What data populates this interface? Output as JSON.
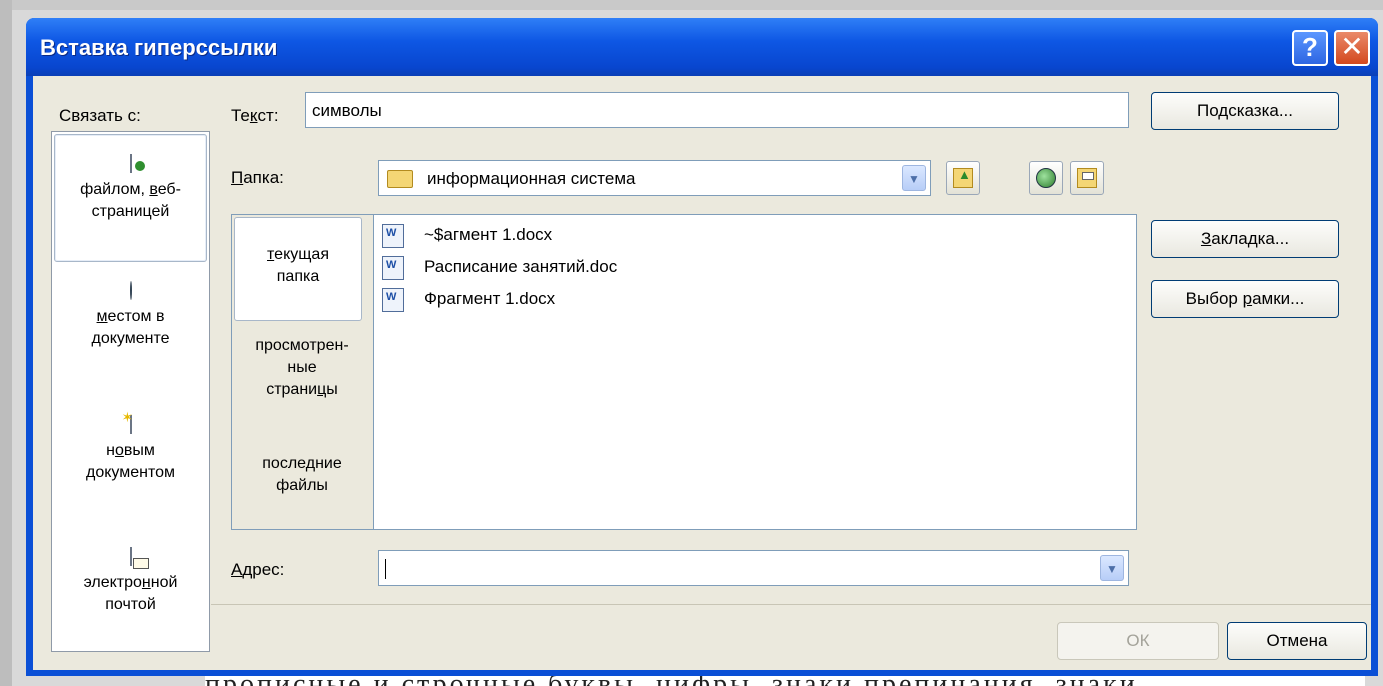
{
  "backdrop": {
    "partial_text": "прописные и строчные буквы, цифры, знаки препинания, знаки"
  },
  "dialog": {
    "title": "Вставка гиперссылки",
    "help_glyph": "?",
    "close_glyph": "✕"
  },
  "link_with": {
    "label": "Связать с:",
    "items": [
      {
        "line1": "файлом, ",
        "line1_u": "в",
        "line1_rest": "еб-",
        "line2": "страницей",
        "icon": "web-page-file-icon",
        "active": true
      },
      {
        "line1_u": "м",
        "line1_rest": "естом в",
        "line2": "документе",
        "icon": "place-in-document-icon",
        "active": false
      },
      {
        "line1": "н",
        "line1_u": "о",
        "line1_rest": "вым",
        "line2": "документом",
        "icon": "new-document-icon",
        "active": false
      },
      {
        "line1": "электро",
        "line1_u": "н",
        "line1_rest": "ной",
        "line2": "почтой",
        "icon": "email-address-icon",
        "active": false
      }
    ]
  },
  "text_field": {
    "label_pre": "Те",
    "label_u": "к",
    "label_post": "ст:",
    "value": "символы"
  },
  "folder": {
    "label_u": "П",
    "label_rest": "апка:",
    "value": "информационная система",
    "arrow_glyph": "▼"
  },
  "look_in": [
    {
      "line1_u": "т",
      "line1_rest": "екущая",
      "line2": "папка",
      "active": true
    },
    {
      "line1": "просмотрен-",
      "line2": "ные",
      "line3": "страни",
      "line3_u": "ц",
      "line3_rest": "ы",
      "active": false
    },
    {
      "line1": "после",
      "line1_u": "д",
      "line1_rest": "ние",
      "line2": "файлы",
      "active": false
    }
  ],
  "files": [
    {
      "name": "~$агмент 1.docx",
      "icon": "word-document-icon"
    },
    {
      "name": "Расписание занятий.doc",
      "icon": "word-document-icon"
    },
    {
      "name": "Фрагмент 1.docx",
      "icon": "word-document-icon"
    }
  ],
  "address": {
    "label_u": "А",
    "label_rest": "дрес:",
    "value": "",
    "arrow_glyph": "▼"
  },
  "buttons": {
    "screentip": {
      "pre": "По",
      "u": "д",
      "post": "сказка..."
    },
    "bookmark": {
      "u": "З",
      "post": "акладка..."
    },
    "target_frame": {
      "pre": "Выбор ",
      "u": "р",
      "post": "амки..."
    },
    "ok": "ОК",
    "cancel": "Отмена"
  }
}
